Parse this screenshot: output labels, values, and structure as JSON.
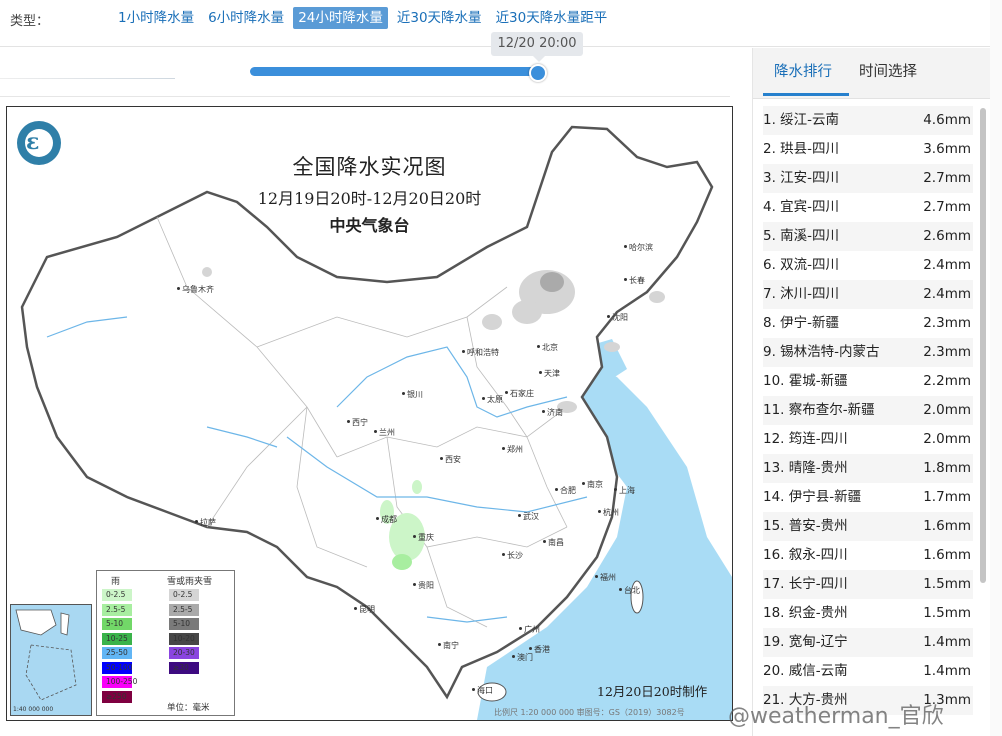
{
  "typebar": {
    "label": "类型：",
    "tabs": [
      "1小时降水量",
      "6小时降水量",
      "24小时降水量",
      "近30天降水量",
      "近30天降水量距平"
    ],
    "active_index": 2
  },
  "timeline": {
    "tooltip": "12/20 20:00",
    "position": 1.0
  },
  "map": {
    "title": "全国降水实况图",
    "period": "12月19日20时-12月20日20时",
    "org": "中央气象台",
    "made": "12月20日20时制作",
    "scale_note": "比例尺 1:20 000 000    审图号：GS（2019）3082号",
    "inset_scale": "1:40 000 000",
    "cities": [
      "乌鲁木齐",
      "哈尔滨",
      "长春",
      "沈阳",
      "呼和浩特",
      "北京",
      "天津",
      "石家庄",
      "太原",
      "银川",
      "济南",
      "西宁",
      "兰州",
      "郑州",
      "西安",
      "合肥",
      "南京",
      "上海",
      "拉萨",
      "成都",
      "重庆",
      "武汉",
      "杭州",
      "长沙",
      "南昌",
      "贵阳",
      "福州",
      "昆明",
      "南宁",
      "广州",
      "台北",
      "澳门",
      "香港",
      "海口"
    ],
    "legend": {
      "rain_header": "雨",
      "snow_header": "雪或雨夹雪",
      "rain": [
        {
          "label": "0-2.5",
          "color": "#ccf5c8"
        },
        {
          "label": "2.5-5",
          "color": "#a8eea0"
        },
        {
          "label": "5-10",
          "color": "#72d868"
        },
        {
          "label": "10-25",
          "color": "#3ab34a"
        },
        {
          "label": "25-50",
          "color": "#62b6f5"
        },
        {
          "label": "50-100",
          "color": "#0000fe"
        },
        {
          "label": "100-250",
          "color": "#fa00fa"
        },
        {
          "label": "≥250",
          "color": "#7f0040"
        }
      ],
      "snow": [
        {
          "label": "0-2.5",
          "color": "#d5d5d5"
        },
        {
          "label": "2.5-5",
          "color": "#aaaaaa"
        },
        {
          "label": "5-10",
          "color": "#7a7a7a"
        },
        {
          "label": "10-20",
          "color": "#474747"
        },
        {
          "label": "20-30",
          "color": "#8a44e0"
        },
        {
          "label": "≥30",
          "color": "#3d0a80"
        }
      ],
      "unit": "单位：毫米"
    }
  },
  "panel": {
    "tabs": [
      "降水排行",
      "时间选择"
    ],
    "active_index": 0,
    "ranking": [
      {
        "name": "1. 绥江-云南",
        "value": "4.6mm"
      },
      {
        "name": "2. 珙县-四川",
        "value": "3.6mm"
      },
      {
        "name": "3. 江安-四川",
        "value": "2.7mm"
      },
      {
        "name": "4. 宜宾-四川",
        "value": "2.7mm"
      },
      {
        "name": "5. 南溪-四川",
        "value": "2.6mm"
      },
      {
        "name": "6. 双流-四川",
        "value": "2.4mm"
      },
      {
        "name": "7. 沐川-四川",
        "value": "2.4mm"
      },
      {
        "name": "8. 伊宁-新疆",
        "value": "2.3mm"
      },
      {
        "name": "9. 锡林浩特-内蒙古",
        "value": "2.3mm"
      },
      {
        "name": "10. 霍城-新疆",
        "value": "2.2mm"
      },
      {
        "name": "11. 察布查尔-新疆",
        "value": "2.0mm"
      },
      {
        "name": "12. 筠连-四川",
        "value": "2.0mm"
      },
      {
        "name": "13. 晴隆-贵州",
        "value": "1.8mm"
      },
      {
        "name": "14. 伊宁县-新疆",
        "value": "1.7mm"
      },
      {
        "name": "15. 普安-贵州",
        "value": "1.6mm"
      },
      {
        "name": "16. 叙永-四川",
        "value": "1.6mm"
      },
      {
        "name": "17. 长宁-四川",
        "value": "1.5mm"
      },
      {
        "name": "18. 织金-贵州",
        "value": "1.5mm"
      },
      {
        "name": "19. 宽甸-辽宁",
        "value": "1.4mm"
      },
      {
        "name": "20. 威信-云南",
        "value": "1.4mm"
      },
      {
        "name": "21. 大方-贵州",
        "value": "1.3mm"
      }
    ]
  },
  "watermark": "@weatherman_官欣"
}
